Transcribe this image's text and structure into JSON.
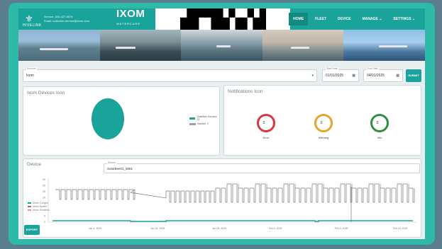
{
  "header": {
    "brand_name": "HIVELINK",
    "contact_service": "Service: 844-427-8579",
    "contact_email": "Email: customer-service@ixom.com",
    "partner_name": "IXOM",
    "partner_sub": "WATERCARE",
    "qr_glyph": "▟▛▜▙▚▞▟"
  },
  "nav": {
    "items": [
      {
        "label": "HOME",
        "active": true
      },
      {
        "label": "FLEET",
        "active": false
      },
      {
        "label": "DEVICE",
        "active": false
      },
      {
        "label": "MANAGE ⌄",
        "active": false
      },
      {
        "label": "SETTINGS ⌄",
        "active": false
      }
    ]
  },
  "filters": {
    "account_label": "Account",
    "account_value": "Ixom",
    "start_label": "Start Date",
    "start_value": "01/01/2025",
    "end_label": "End Date",
    "end_value": "04/01/2025",
    "submit_label": "SUBMIT"
  },
  "device_card": {
    "title": "Ixom Devices Icon",
    "legend": [
      {
        "label": "SolarBee Devices: 22",
        "color": "#1aa39a"
      },
      {
        "label": "Inactive: 0",
        "color": "#9aa2a6"
      }
    ]
  },
  "notifications_card": {
    "title": "Notifications Icon",
    "items": [
      {
        "label": "Error",
        "count": "0",
        "color": "#d9383f"
      },
      {
        "label": "Warning",
        "count": "0",
        "color": "#e3a62b"
      },
      {
        "label": "Info",
        "count": "0",
        "color": "#2f8f3e"
      }
    ]
  },
  "device_chart_card": {
    "title": "Device",
    "device_label": "Device",
    "device_value": "SolarBee01_5081",
    "legend": [
      "Motor Current",
      "Motor Speed",
      "Motor Direction"
    ],
    "export_label": "EXPORT"
  },
  "chart_data": {
    "type": "line",
    "title": "",
    "xlabel": "",
    "ylabel": "",
    "x_ticks": [
      "Jan 4, 2025",
      "Jan 19, 2025",
      "Jan 28, 2025",
      "Feb 6, 2025",
      "Feb 9, 2025",
      "Feb 18, 2025"
    ],
    "y_ticks": [
      "35",
      "30",
      "25",
      "20",
      "15",
      "10",
      "5",
      "0"
    ],
    "ylim": [
      0,
      35
    ],
    "series": [
      {
        "name": "Motor Current",
        "color": "#1aa39a"
      },
      {
        "name": "Motor Speed",
        "color": "#7a7a7a"
      },
      {
        "name": "Motor Direction",
        "color": "#e29a7a"
      }
    ]
  },
  "colors": {
    "accent": "#1aa39a",
    "accent_dark": "#128a82"
  }
}
